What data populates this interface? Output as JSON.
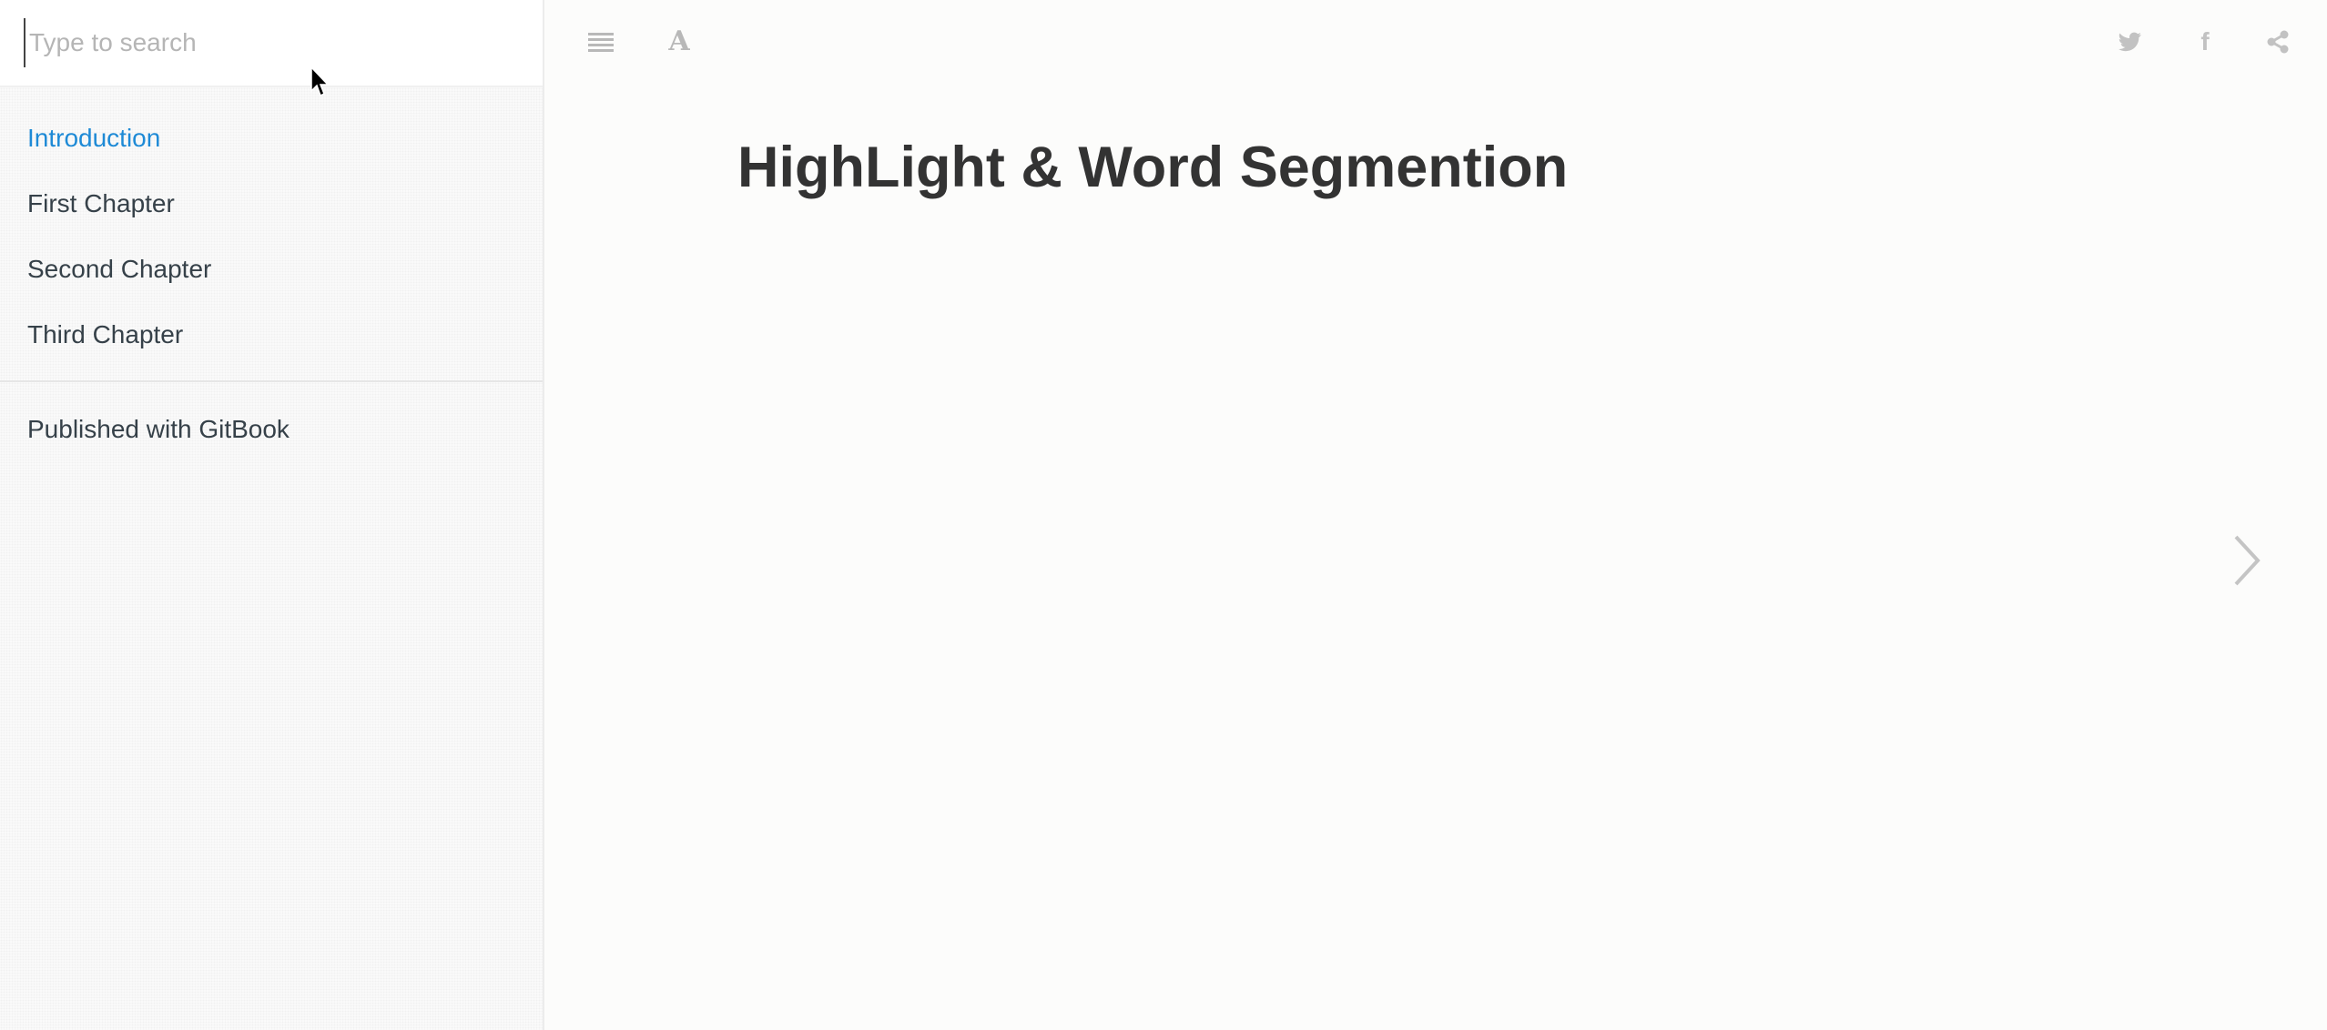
{
  "search": {
    "placeholder": "Type to search",
    "value": ""
  },
  "sidebar": {
    "items": [
      {
        "label": "Introduction",
        "active": true
      },
      {
        "label": "First Chapter",
        "active": false
      },
      {
        "label": "Second Chapter",
        "active": false
      },
      {
        "label": "Third Chapter",
        "active": false
      }
    ],
    "published_label": "Published with GitBook"
  },
  "toolbar": {
    "left_icons": [
      "list-icon",
      "font-settings-icon"
    ],
    "right_icons": [
      "twitter-icon",
      "facebook-icon",
      "share-icon"
    ],
    "font_glyph": "A",
    "facebook_glyph": "f"
  },
  "page": {
    "title": "HighLight & Word Segmention"
  },
  "colors": {
    "accent": "#1e8ad6",
    "nav_text": "#364149",
    "title_text": "#333333",
    "icon_gray": "#b8b8b8",
    "background": "#fcfcfb"
  }
}
